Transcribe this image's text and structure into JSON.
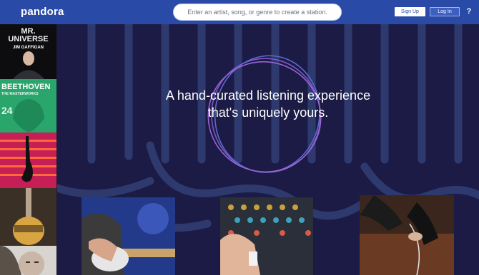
{
  "header": {
    "logo": "pandora",
    "search_placeholder": "Enter an artist, song, or genre to create a station.",
    "signup_label": "Sign Up",
    "login_label": "Log In",
    "help_label": "?"
  },
  "hero": {
    "tagline_line1": "A hand-curated listening experience",
    "tagline_line2": "that's uniquely yours."
  },
  "albums": {
    "mr_universe_title": "MR. UNIVERSE",
    "mr_universe_artist": "JIM GAFFIGAN",
    "beethoven_title": "BEETHOVEN",
    "beethoven_sub": "THE MASTERWORKS",
    "twenty_four": "24"
  },
  "colors": {
    "header_bg": "#2a4aa8",
    "hero_bg": "#1c1b45",
    "ring_accent": "#9a63d6"
  }
}
